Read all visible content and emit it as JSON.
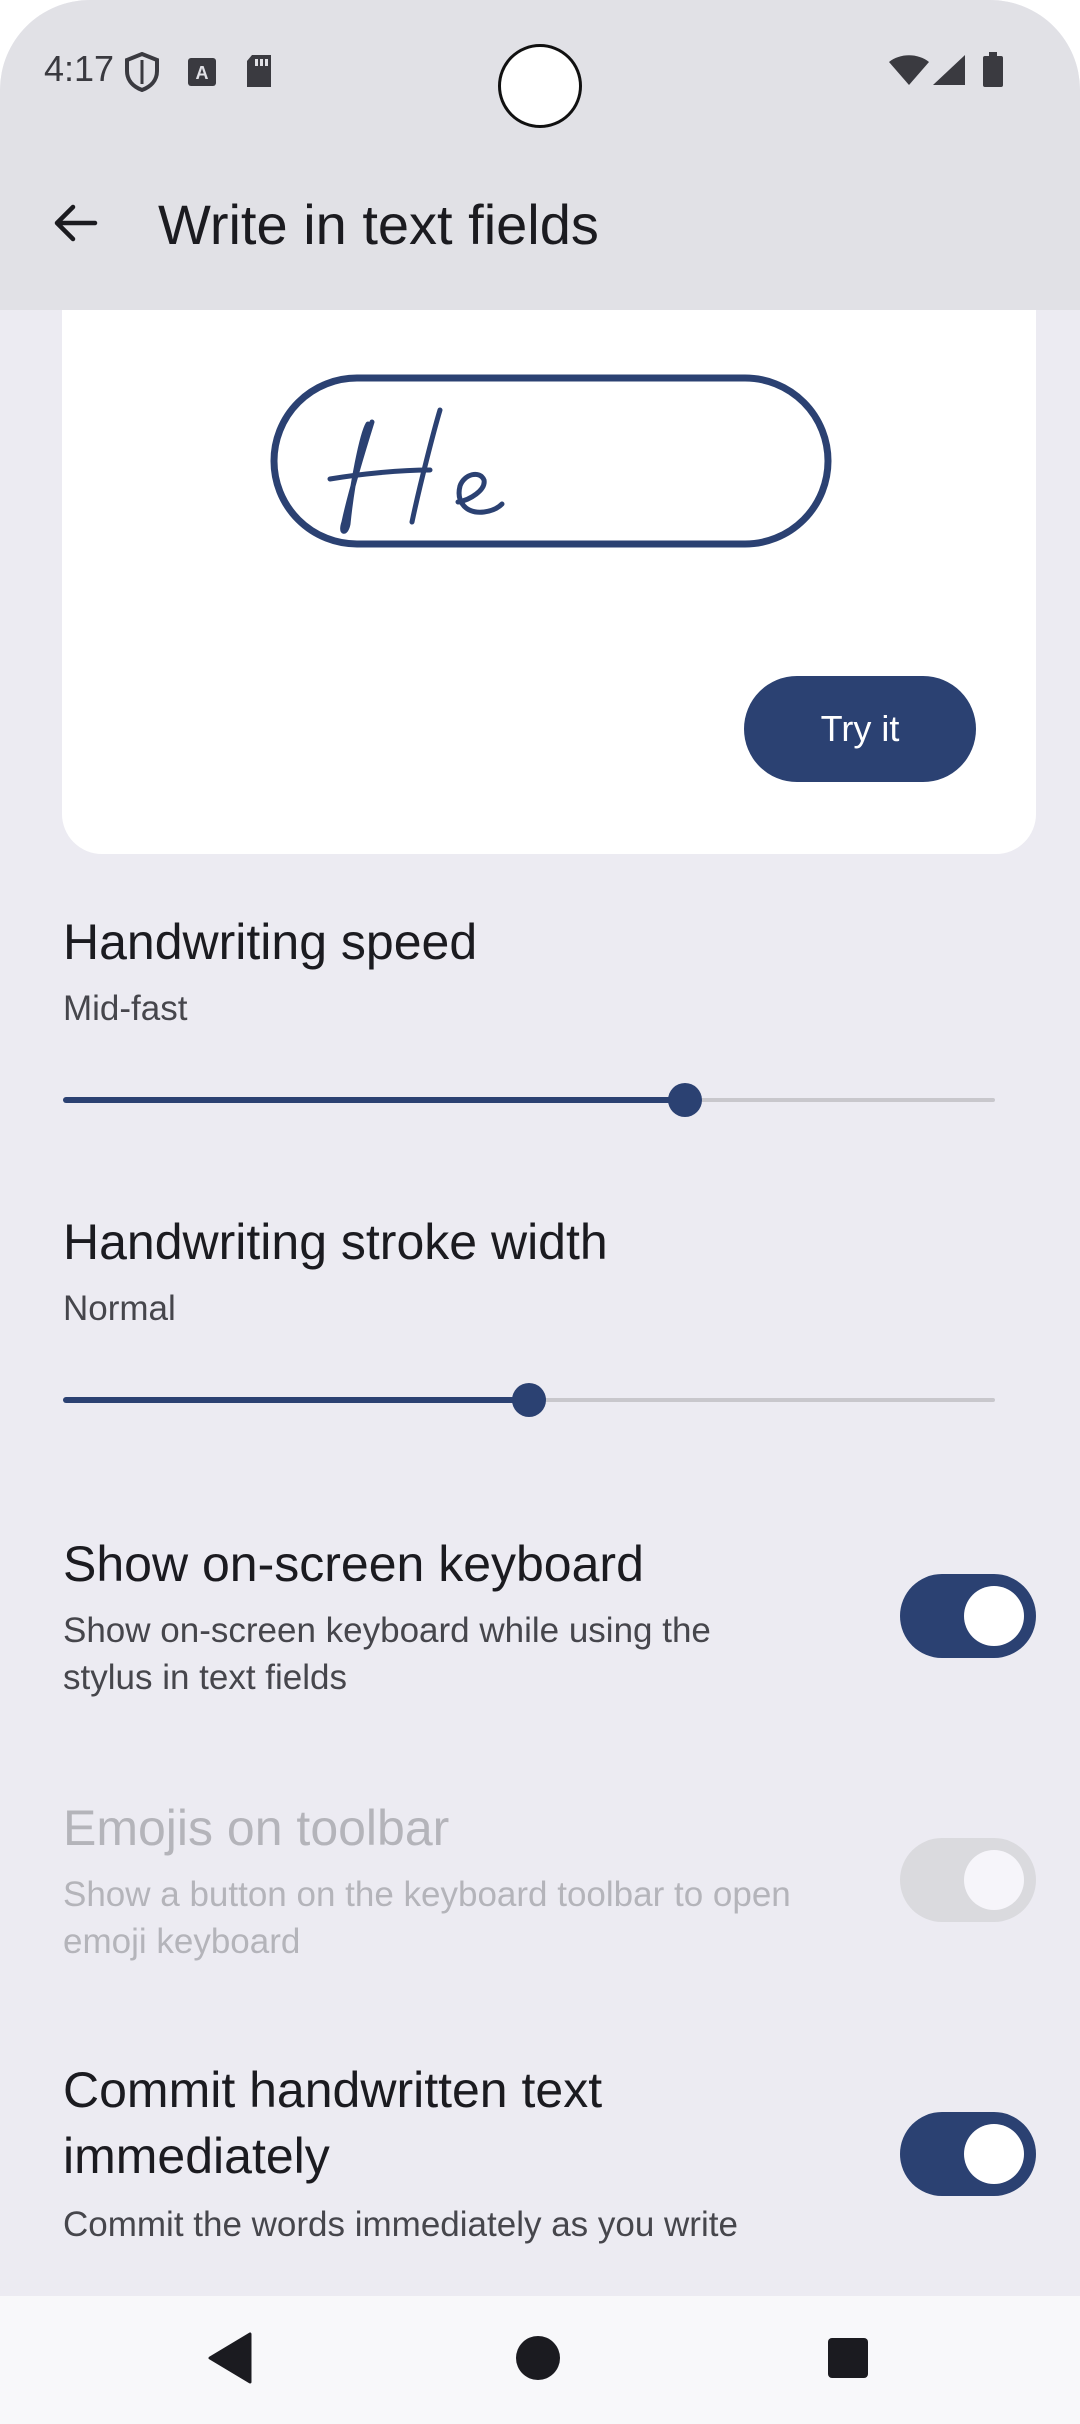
{
  "status_bar": {
    "time": "4:17",
    "icons_left": [
      "shield-icon",
      "keyboard-a-icon",
      "sd-card-icon"
    ],
    "icons_right": [
      "wifi-icon",
      "cell-signal-icon",
      "battery-icon"
    ]
  },
  "app_bar": {
    "title": "Write in text fields",
    "back_icon": "arrow-back-icon"
  },
  "preview": {
    "handwriting_sample": "He",
    "try_button": "Try it"
  },
  "settings": {
    "speed": {
      "title": "Handwriting speed",
      "value": "Mid-fast",
      "level": 0.667
    },
    "stroke": {
      "title": "Handwriting stroke width",
      "value": "Normal",
      "level": 0.5
    },
    "keyboard": {
      "title": "Show on-screen keyboard",
      "subtitle_1": "Show on-screen keyboard while using the",
      "subtitle_2": "stylus in text fields",
      "enabled": true
    },
    "emojis": {
      "title": "Emojis on toolbar",
      "subtitle_1": "Show a button on the keyboard toolbar to open",
      "subtitle_2": "emoji keyboard",
      "enabled": false,
      "disabled": true
    },
    "commit": {
      "title_1": "Commit handwritten text",
      "title_2": "immediately",
      "subtitle": "Commit the words immediately as you write",
      "enabled": true
    }
  },
  "colors": {
    "accent": "#2B4172",
    "background": "#ECEBF2",
    "app_bar": "#E1E1E6"
  },
  "nav_bar": {
    "icons": [
      "back-triangle-icon",
      "home-circle-icon",
      "recents-square-icon"
    ]
  }
}
